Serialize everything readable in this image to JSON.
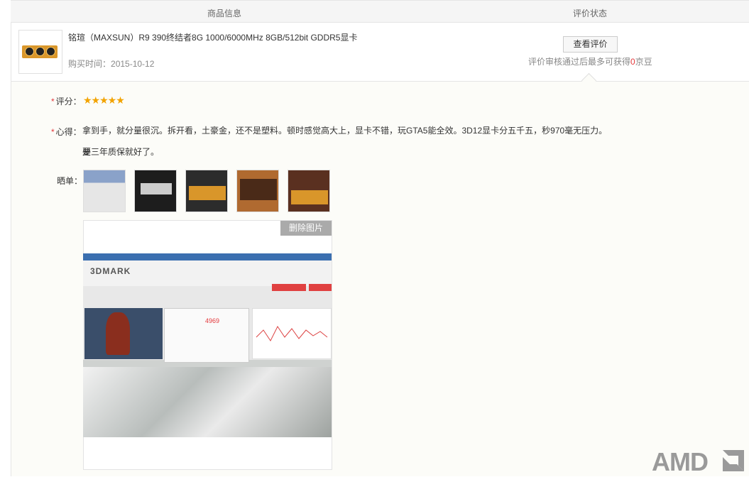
{
  "header": {
    "col1": "商品信息",
    "col2": "评价状态"
  },
  "product": {
    "name": "铭瑄（MAXSUN）R9 390终结者8G 1000/6000MHz 8GB/512bit GDDR5显卡",
    "purchase_label": "购买时间：",
    "purchase_date": "2015-10-12"
  },
  "status": {
    "button_label": "查看评价",
    "note_prefix": "评价审核通过后最多可获得",
    "note_count": "0",
    "note_suffix": "京豆"
  },
  "review": {
    "required_mark": "*",
    "rating_label": "评分：",
    "rating": 5,
    "rating_stars": "★★★★★",
    "comment_label": "心得：",
    "comment_line1": "拿到手，就分量很沉。拆开看，土豪金，还不是塑料。顿时感觉高大上，显卡不错，玩GTA5能全效。3D12显卡分五千五，秒970毫无压力。要",
    "comment_line2": "是三年质保就好了。",
    "photos_label": "晒单：",
    "photo_count": 5,
    "delete_button": "删除图片"
  },
  "screenshot": {
    "app_logo": "3DMARK",
    "score": "4969"
  },
  "brand": {
    "logo": "AMD"
  },
  "colors": {
    "accent": "#e4393c",
    "star": "#f2a300"
  }
}
